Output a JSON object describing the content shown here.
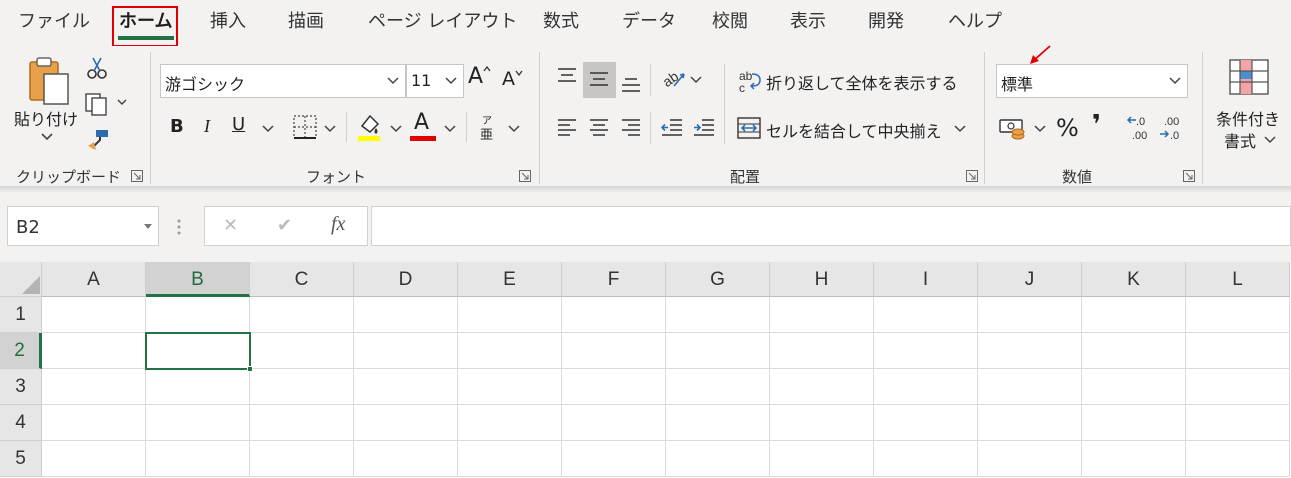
{
  "tabs": [
    {
      "label": "ファイル",
      "active": false
    },
    {
      "label": "ホーム",
      "active": true
    },
    {
      "label": "挿入",
      "active": false
    },
    {
      "label": "描画",
      "active": false
    },
    {
      "label": "ページ レイアウト",
      "active": false
    },
    {
      "label": "数式",
      "active": false
    },
    {
      "label": "データ",
      "active": false
    },
    {
      "label": "校閲",
      "active": false
    },
    {
      "label": "表示",
      "active": false
    },
    {
      "label": "開発",
      "active": false
    },
    {
      "label": "ヘルプ",
      "active": false
    }
  ],
  "clipboard": {
    "paste_label": "貼り付け",
    "group_label": "クリップボード",
    "icons": [
      "clipboard-icon",
      "scissors-icon",
      "copy-icon",
      "format-painter-icon"
    ]
  },
  "font": {
    "font_name": "游ゴシック",
    "font_size": "11",
    "group_label": "フォント",
    "bold": "B",
    "italic": "I",
    "underline": "U",
    "increase_size": "A",
    "decrease_size": "A",
    "font_color_glyph": "A",
    "phonetic_glyph_top": "ア",
    "phonetic_glyph_bottom": "亜",
    "highlight_color": "#ffff00",
    "font_color": "#e00000"
  },
  "alignment": {
    "wrap_text_label": "折り返して全体を表示する",
    "merge_center_label": "セルを結合して中央揃え",
    "group_label": "配置",
    "wrap_icon_glyph": "ab"
  },
  "number": {
    "format_value": "標準",
    "group_label": "数値",
    "percent": "%",
    "comma": "❜",
    "increase_decimal": ".00",
    "decrease_decimal": ".0"
  },
  "styles": {
    "conditional_format_line1": "条件付き",
    "conditional_format_line2": "書式"
  },
  "formula_bar": {
    "name_box": "B2",
    "fx": "fx",
    "cancel": "✕",
    "enter": "✔",
    "formula": ""
  },
  "grid": {
    "columns": [
      "A",
      "B",
      "C",
      "D",
      "E",
      "F",
      "G",
      "H",
      "I",
      "J",
      "K",
      "L"
    ],
    "rows": [
      "1",
      "2",
      "3",
      "4",
      "5"
    ],
    "selected_column": "B",
    "selected_row": "2"
  },
  "colors": {
    "accent": "#217346",
    "annotation": "#e00000",
    "ribbon_bg": "#f3f2f1"
  }
}
